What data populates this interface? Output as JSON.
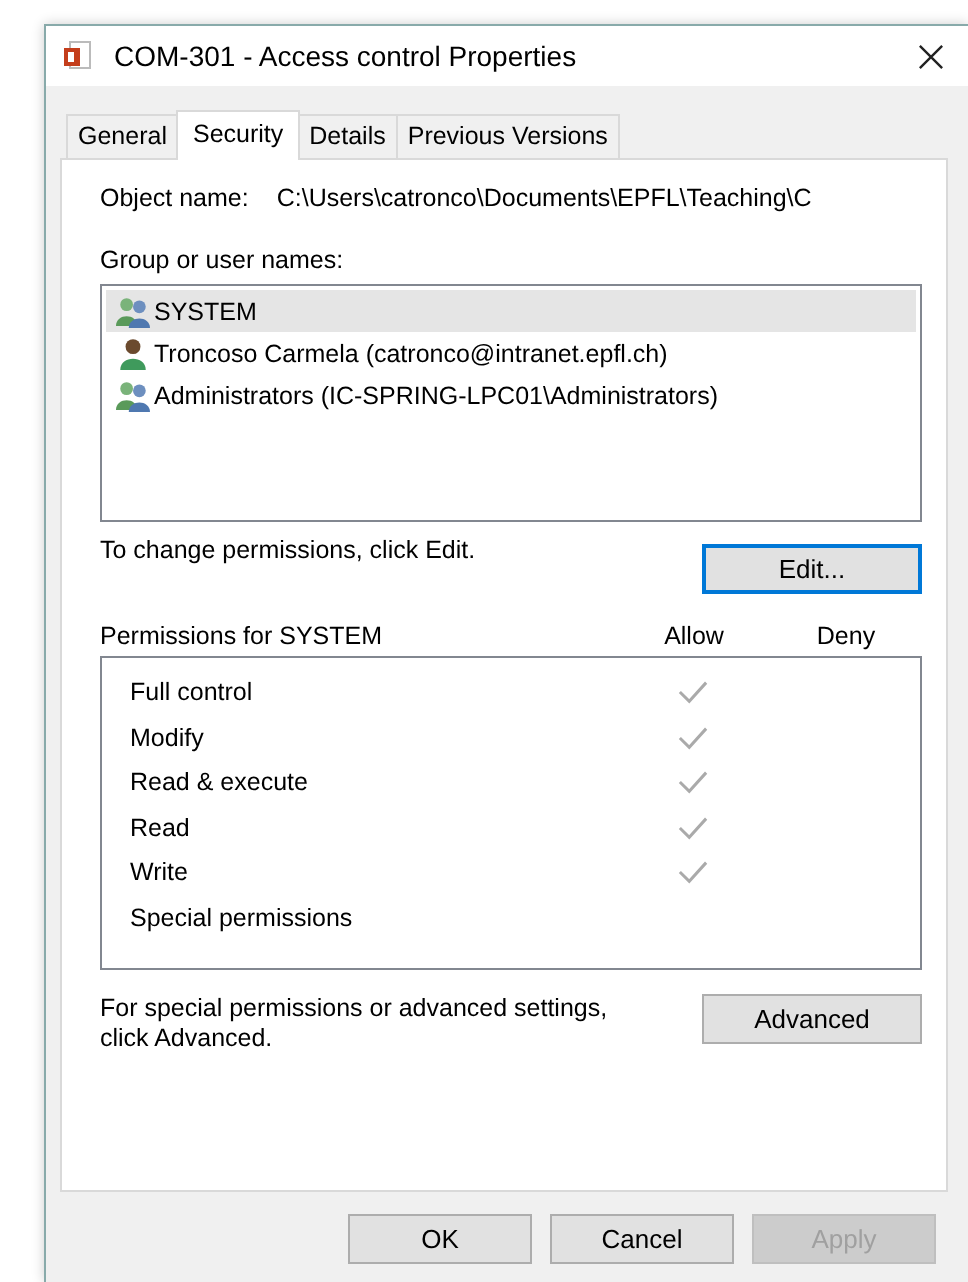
{
  "window": {
    "title": "COM-301 - Access control Properties"
  },
  "tabs": [
    {
      "label": "General",
      "selected": false
    },
    {
      "label": "Security",
      "selected": true
    },
    {
      "label": "Details",
      "selected": false
    },
    {
      "label": "Previous Versions",
      "selected": false
    }
  ],
  "object_name": {
    "label": "Object name:",
    "value": "C:\\Users\\catronco\\Documents\\EPFL\\Teaching\\C"
  },
  "group_names": {
    "label": "Group or user names:",
    "items": [
      {
        "name": "SYSTEM",
        "kind": "group",
        "selected": true
      },
      {
        "name": "Troncoso Carmela (catronco@intranet.epfl.ch)",
        "kind": "user",
        "selected": false
      },
      {
        "name": "Administrators (IC-SPRING-LPC01\\Administrators)",
        "kind": "group",
        "selected": false
      }
    ]
  },
  "change_hint": "To change permissions, click Edit.",
  "edit_button": "Edit...",
  "permissions": {
    "title": "Permissions for SYSTEM",
    "columns": [
      "Allow",
      "Deny"
    ],
    "rows": [
      {
        "name": "Full control",
        "allow": true,
        "deny": false
      },
      {
        "name": "Modify",
        "allow": true,
        "deny": false
      },
      {
        "name": "Read & execute",
        "allow": true,
        "deny": false
      },
      {
        "name": "Read",
        "allow": true,
        "deny": false
      },
      {
        "name": "Write",
        "allow": true,
        "deny": false
      },
      {
        "name": "Special permissions",
        "allow": false,
        "deny": false
      }
    ]
  },
  "advanced_hint": "For special permissions or advanced settings, click Advanced.",
  "advanced_button": "Advanced",
  "buttons": [
    {
      "label": "OK",
      "disabled": false
    },
    {
      "label": "Cancel",
      "disabled": false
    },
    {
      "label": "Apply",
      "disabled": true
    }
  ]
}
